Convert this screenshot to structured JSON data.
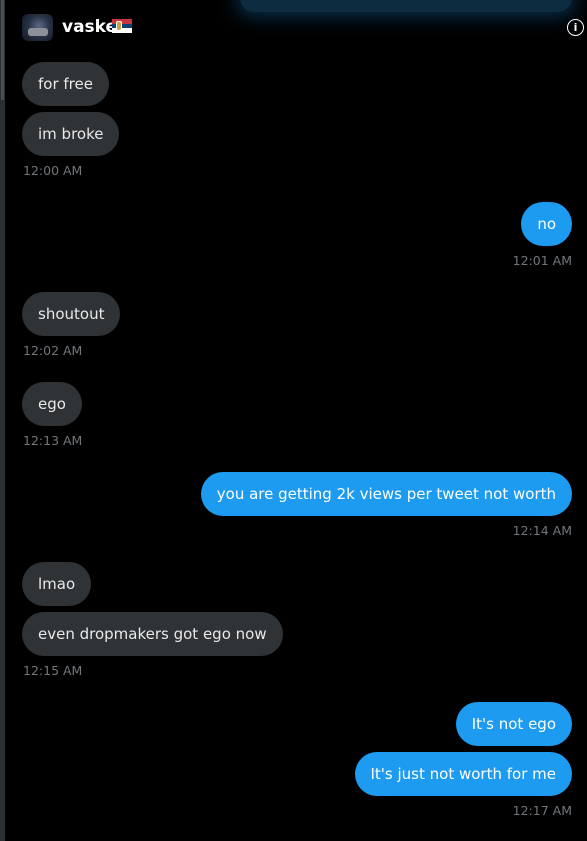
{
  "header": {
    "name": "vaske",
    "flag_icon": "serbia-flag-icon",
    "info_icon": "info-icon"
  },
  "messages": [
    {
      "side": "in",
      "text": "for free"
    },
    {
      "side": "in",
      "text": "im broke"
    },
    {
      "side": "out",
      "text": "no"
    },
    {
      "side": "in",
      "text": "shoutout"
    },
    {
      "side": "in",
      "text": "ego"
    },
    {
      "side": "out",
      "text": "you are getting 2k views per tweet not worth"
    },
    {
      "side": "in",
      "text": "lmao"
    },
    {
      "side": "in",
      "text": "even dropmakers got ego now"
    },
    {
      "side": "out",
      "text": "It's not ego"
    },
    {
      "side": "out",
      "text": "It's just not worth for me"
    }
  ],
  "timestamps": [
    "12:00 AM",
    "12:01 AM",
    "12:02 AM",
    "12:13 AM",
    "12:14 AM",
    "12:15 AM",
    "12:17 AM"
  ],
  "colors": {
    "incoming": "#2f3336",
    "outgoing": "#1d9bf0",
    "background": "#000000",
    "timestamp": "#71767b"
  }
}
